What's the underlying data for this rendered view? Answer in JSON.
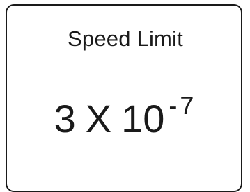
{
  "sign": {
    "title": "Speed Limit",
    "coefficient": "3",
    "operator": "X",
    "base": "10",
    "exponent": "-7"
  }
}
